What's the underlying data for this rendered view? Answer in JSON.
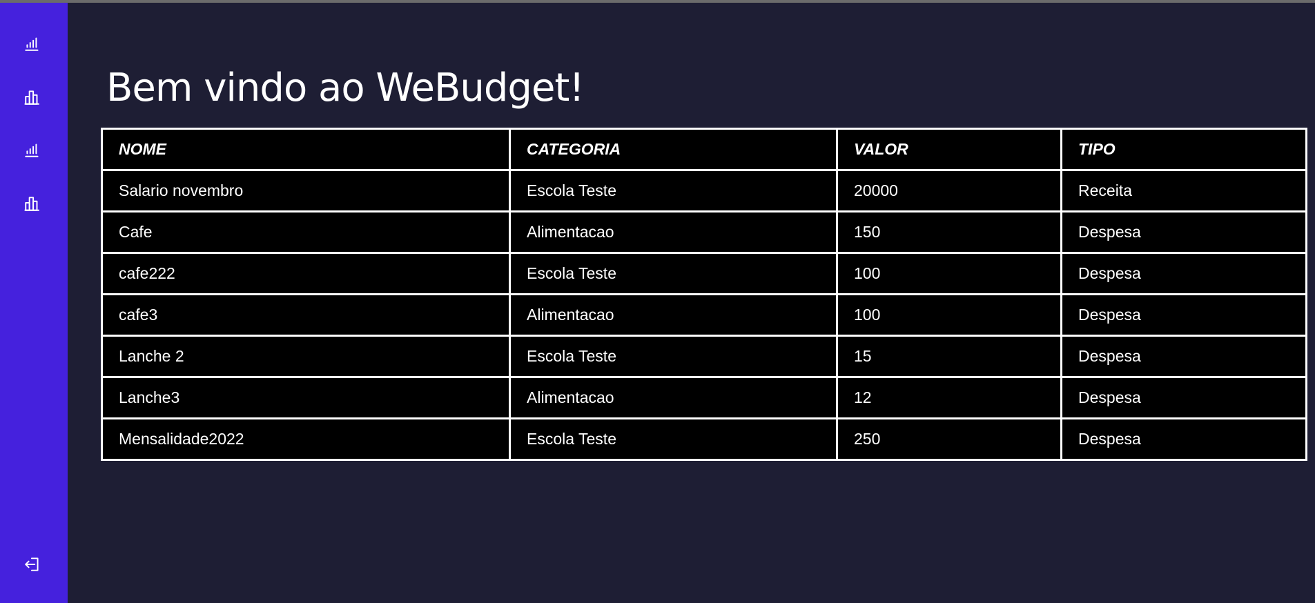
{
  "app": {
    "title": "Bem vindo ao WeBudget!"
  },
  "sidebar": {
    "items": [
      {
        "icon": "signal-bars-icon"
      },
      {
        "icon": "bar-chart-icon"
      },
      {
        "icon": "signal-bars-icon"
      },
      {
        "icon": "bar-chart-icon"
      }
    ],
    "logout_icon": "logout-icon"
  },
  "table": {
    "headers": [
      "NOME",
      "CATEGORIA",
      "VALOR",
      "TIPO"
    ],
    "rows": [
      [
        "Salario novembro",
        "Escola Teste",
        "20000",
        "Receita"
      ],
      [
        "Cafe",
        "Alimentacao",
        "150",
        "Despesa"
      ],
      [
        "cafe222",
        "Escola Teste",
        "100",
        "Despesa"
      ],
      [
        "cafe3",
        "Alimentacao",
        "100",
        "Despesa"
      ],
      [
        "Lanche 2",
        "Escola Teste",
        "15",
        "Despesa"
      ],
      [
        "Lanche3",
        "Alimentacao",
        "12",
        "Despesa"
      ],
      [
        "Mensalidade2022",
        "Escola Teste",
        "250",
        "Despesa"
      ]
    ]
  },
  "colors": {
    "sidebar": "#4521dd",
    "background": "#1e1e34",
    "table_background": "#000000",
    "text": "#ffffff"
  }
}
